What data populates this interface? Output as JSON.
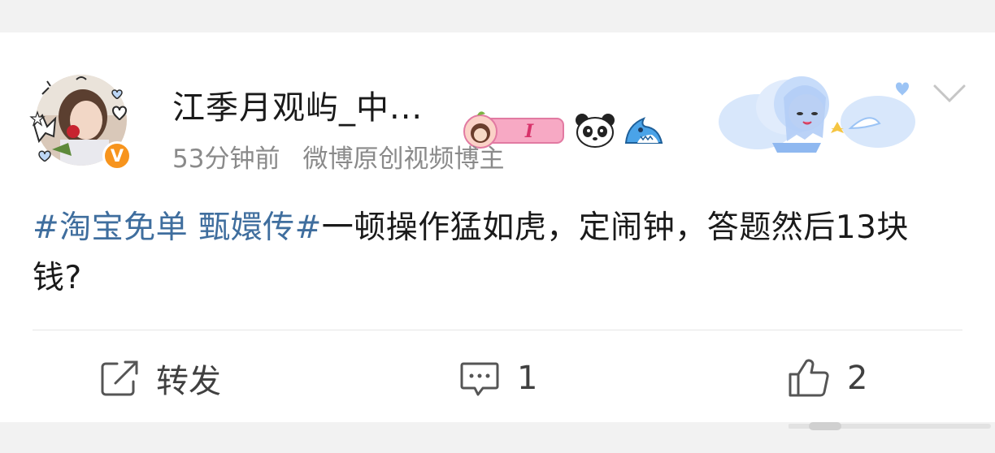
{
  "post": {
    "username": "江季月观屿_中...",
    "fan_badge_level": "I",
    "time": "53分钟前",
    "source": "微博原创视频博主",
    "topic": "#淘宝免单 甄嬛传#",
    "text": "一顿操作猛如虎，定闹钟，答题然后13块钱?"
  },
  "actions": {
    "repost_label": "转发",
    "comment_count": "1",
    "like_count": "2"
  },
  "icons": {
    "verified": "verified-v-icon",
    "panda": "panda-icon",
    "shark": "shark-icon",
    "menu": "chevron-down-icon",
    "repost": "share-edit-icon",
    "comment": "comment-icon",
    "like": "thumbs-up-icon"
  },
  "colors": {
    "topic": "#3f6e9e",
    "verified_badge": "#f7941d",
    "text": "#1a1a1a",
    "meta": "#8a8a8a"
  }
}
